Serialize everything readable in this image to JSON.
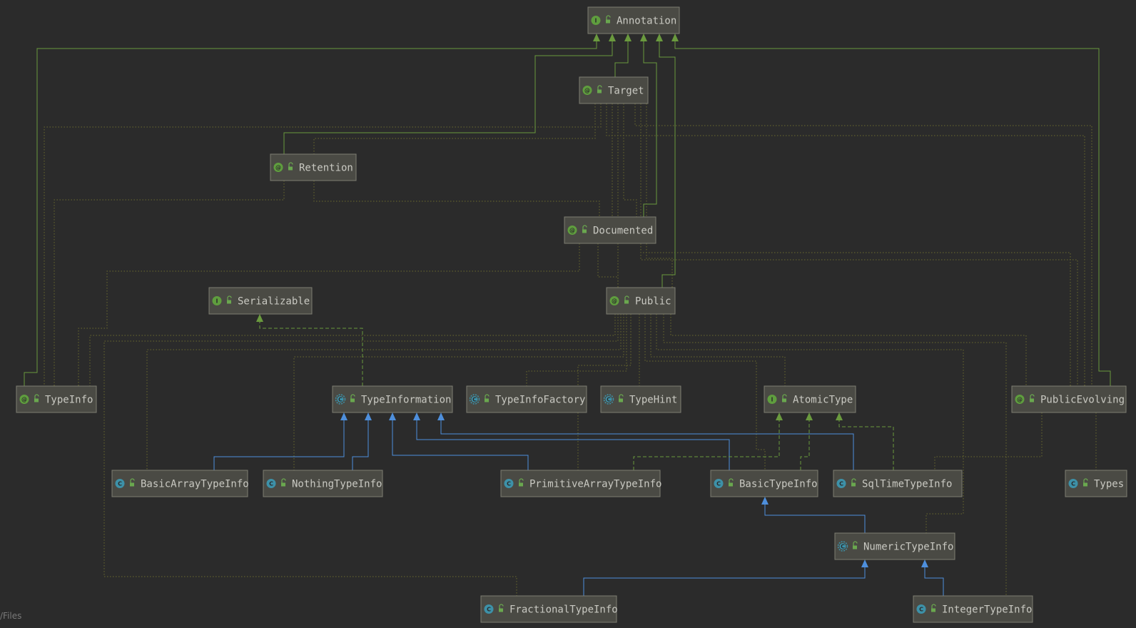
{
  "footer_text": "/Files",
  "badge_colors": {
    "annotation": "#5f9e3e",
    "interface": "#5f9e3e",
    "class": "#3d91a8",
    "abstract": "#3d91a8"
  },
  "nodes": [
    {
      "id": "annotation",
      "label": "Annotation",
      "kind": "interface",
      "icon": "interface-icon",
      "badge": "I"
    },
    {
      "id": "target",
      "label": "Target",
      "kind": "annotation",
      "icon": "annotation-icon",
      "badge": "@"
    },
    {
      "id": "retention",
      "label": "Retention",
      "kind": "annotation",
      "icon": "annotation-icon",
      "badge": "@"
    },
    {
      "id": "documented",
      "label": "Documented",
      "kind": "annotation",
      "icon": "annotation-icon",
      "badge": "@"
    },
    {
      "id": "serializable",
      "label": "Serializable",
      "kind": "interface",
      "icon": "interface-icon",
      "badge": "I"
    },
    {
      "id": "public",
      "label": "Public",
      "kind": "annotation",
      "icon": "annotation-icon",
      "badge": "@"
    },
    {
      "id": "typeinfo",
      "label": "TypeInfo",
      "kind": "annotation",
      "icon": "annotation-icon",
      "badge": "@"
    },
    {
      "id": "typeinformation",
      "label": "TypeInformation",
      "kind": "abstract",
      "icon": "abstract-class-icon",
      "badge": "C"
    },
    {
      "id": "typeinfofactory",
      "label": "TypeInfoFactory",
      "kind": "abstract",
      "icon": "abstract-class-icon",
      "badge": "C"
    },
    {
      "id": "typehint",
      "label": "TypeHint",
      "kind": "abstract",
      "icon": "abstract-class-icon",
      "badge": "C"
    },
    {
      "id": "atomictype",
      "label": "AtomicType",
      "kind": "interface",
      "icon": "interface-icon",
      "badge": "I"
    },
    {
      "id": "publicevolving",
      "label": "PublicEvolving",
      "kind": "annotation",
      "icon": "annotation-icon",
      "badge": "@"
    },
    {
      "id": "basicarraytypeinfo",
      "label": "BasicArrayTypeInfo",
      "kind": "class",
      "icon": "class-icon",
      "badge": "C"
    },
    {
      "id": "nothingtypeinfo",
      "label": "NothingTypeInfo",
      "kind": "class",
      "icon": "class-icon",
      "badge": "C"
    },
    {
      "id": "primitivearraytypeinfo",
      "label": "PrimitiveArrayTypeInfo",
      "kind": "class",
      "icon": "class-icon",
      "badge": "C"
    },
    {
      "id": "basictypeinfo",
      "label": "BasicTypeInfo",
      "kind": "class",
      "icon": "class-icon",
      "badge": "C"
    },
    {
      "id": "sqltimetypeinfo",
      "label": "SqlTimeTypeInfo",
      "kind": "class",
      "icon": "class-icon",
      "badge": "C"
    },
    {
      "id": "types",
      "label": "Types",
      "kind": "class",
      "icon": "class-icon",
      "badge": "C"
    },
    {
      "id": "numerictypeinfo",
      "label": "NumericTypeInfo",
      "kind": "abstract",
      "icon": "abstract-class-icon",
      "badge": "C"
    },
    {
      "id": "fractionaltypeinfo",
      "label": "FractionalTypeInfo",
      "kind": "class",
      "icon": "class-icon",
      "badge": "C"
    },
    {
      "id": "integertypeinfo",
      "label": "IntegerTypeInfo",
      "kind": "class",
      "icon": "class-icon",
      "badge": "C"
    }
  ],
  "edges": [
    {
      "from": "target",
      "to": "annotation",
      "type": "extends"
    },
    {
      "from": "retention",
      "to": "annotation",
      "type": "extends"
    },
    {
      "from": "documented",
      "to": "annotation",
      "type": "extends"
    },
    {
      "from": "public",
      "to": "annotation",
      "type": "extends"
    },
    {
      "from": "typeinfo",
      "to": "annotation",
      "type": "extends"
    },
    {
      "from": "publicevolving",
      "to": "annotation",
      "type": "extends"
    },
    {
      "from": "typeinformation",
      "to": "serializable",
      "type": "implements"
    },
    {
      "from": "basicarraytypeinfo",
      "to": "typeinformation",
      "type": "extends"
    },
    {
      "from": "nothingtypeinfo",
      "to": "typeinformation",
      "type": "extends"
    },
    {
      "from": "primitivearraytypeinfo",
      "to": "typeinformation",
      "type": "extends"
    },
    {
      "from": "basictypeinfo",
      "to": "typeinformation",
      "type": "extends"
    },
    {
      "from": "sqltimetypeinfo",
      "to": "typeinformation",
      "type": "extends"
    },
    {
      "from": "primitivearraytypeinfo",
      "to": "atomictype",
      "type": "implements"
    },
    {
      "from": "basictypeinfo",
      "to": "atomictype",
      "type": "implements"
    },
    {
      "from": "sqltimetypeinfo",
      "to": "atomictype",
      "type": "implements"
    },
    {
      "from": "numerictypeinfo",
      "to": "basictypeinfo",
      "type": "extends"
    },
    {
      "from": "fractionaltypeinfo",
      "to": "numerictypeinfo",
      "type": "extends"
    },
    {
      "from": "integertypeinfo",
      "to": "numerictypeinfo",
      "type": "extends"
    }
  ]
}
